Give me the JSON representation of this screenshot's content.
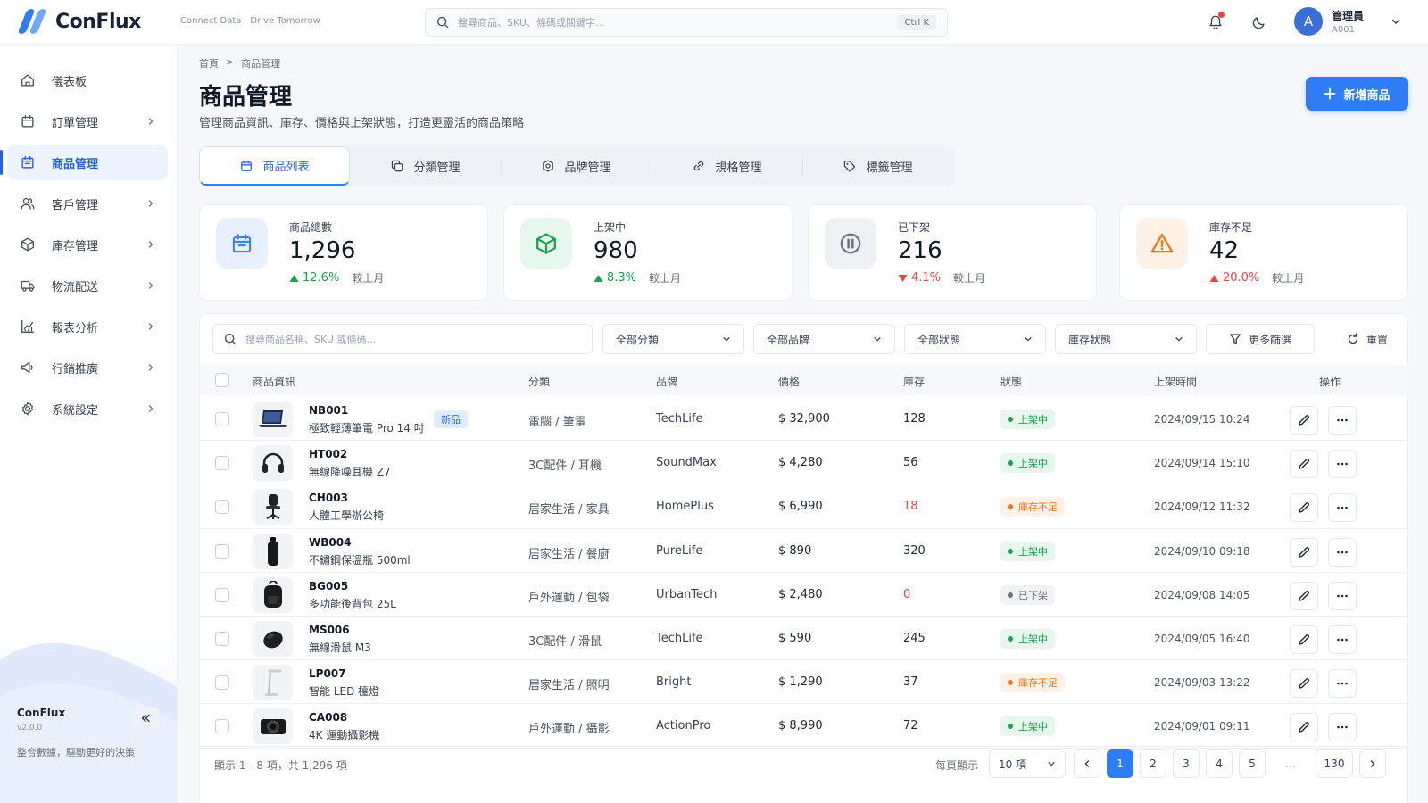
{
  "app": {
    "name": "ConFlux",
    "tagline": [
      "Connect Data",
      "Drive Tomorrow"
    ]
  },
  "topbar": {
    "search_placeholder": "搜尋商品、SKU、條碼或關鍵字...",
    "shortcut": "Ctrl K",
    "user": {
      "initial": "A",
      "name": "管理員",
      "id": "A001"
    },
    "icons": [
      "bell-icon",
      "moon-icon",
      "chevron-down-icon"
    ]
  },
  "sidebar": {
    "items": [
      {
        "label": "儀表板",
        "icon": "home-icon",
        "chevron": false,
        "active": false
      },
      {
        "label": "訂單管理",
        "icon": "order-icon",
        "chevron": true,
        "active": false
      },
      {
        "label": "商品管理",
        "icon": "product-icon",
        "chevron": false,
        "active": true
      },
      {
        "label": "客戶管理",
        "icon": "users-icon",
        "chevron": true,
        "active": false
      },
      {
        "label": "庫存管理",
        "icon": "box-icon",
        "chevron": true,
        "active": false
      },
      {
        "label": "物流配送",
        "icon": "truck-icon",
        "chevron": true,
        "active": false
      },
      {
        "label": "報表分析",
        "icon": "chart-icon",
        "chevron": true,
        "active": false
      },
      {
        "label": "行銷推廣",
        "icon": "megaphone-icon",
        "chevron": true,
        "active": false
      },
      {
        "label": "系統設定",
        "icon": "gear-icon",
        "chevron": true,
        "active": false
      }
    ],
    "footer": {
      "brand": "ConFlux",
      "version": "v2.0.0",
      "slogan": "整合數據，驅動更好的決策"
    }
  },
  "page": {
    "breadcrumb": [
      "首頁",
      "商品管理"
    ],
    "title": "商品管理",
    "subtitle": "管理商品資訊、庫存、價格與上架狀態，打造更靈活的商品策略",
    "add_button": "新增商品"
  },
  "tabs": [
    {
      "label": "商品列表",
      "icon": "calendar-bag-icon",
      "active": true
    },
    {
      "label": "分類管理",
      "icon": "layers-icon",
      "active": false
    },
    {
      "label": "品牌管理",
      "icon": "badge-icon",
      "active": false
    },
    {
      "label": "規格管理",
      "icon": "link-icon",
      "active": false
    },
    {
      "label": "標籤管理",
      "icon": "tag-icon",
      "active": false
    }
  ],
  "stats": [
    {
      "label": "商品總數",
      "value": "1,296",
      "change": "12.6%",
      "direction": "up",
      "compare": "較上月",
      "color": "#3b82f6",
      "bg": "#e8f0ff",
      "change_color": "#16a34a"
    },
    {
      "label": "上架中",
      "value": "980",
      "change": "8.3%",
      "direction": "up",
      "compare": "較上月",
      "color": "#16a34a",
      "bg": "#e6f7ee",
      "change_color": "#16a34a"
    },
    {
      "label": "已下架",
      "value": "216",
      "change": "4.1%",
      "direction": "down",
      "compare": "較上月",
      "color": "#6b7280",
      "bg": "#eef0f4",
      "change_color": "#ef4444"
    },
    {
      "label": "庫存不足",
      "value": "42",
      "change": "20.0%",
      "direction": "up",
      "compare": "較上月",
      "color": "#f97316",
      "bg": "#fff1e6",
      "change_color": "#ef4444"
    }
  ],
  "filters": {
    "search_placeholder": "搜尋商品名稱、SKU 或條碼...",
    "selects": [
      "全部分類",
      "全部品牌",
      "全部狀態",
      "庫存狀態"
    ],
    "more": "更多篩選",
    "reset": "重置"
  },
  "table": {
    "headers": [
      "商品資訊",
      "分類",
      "品牌",
      "價格",
      "庫存",
      "狀態",
      "上架時間",
      "操作"
    ],
    "rows": [
      {
        "sku": "NB001",
        "name": "極致輕薄筆電 Pro 14 吋",
        "tag": "新品",
        "thumb": "laptop",
        "category": "電腦 / 筆電",
        "brand": "TechLife",
        "price": "$ 32,900",
        "stock": "128",
        "low": false,
        "status": "上架中",
        "status_type": "on",
        "time": "2024/09/15 10:24"
      },
      {
        "sku": "HT002",
        "name": "無線降噪耳機 Z7",
        "tag": "",
        "thumb": "headphones",
        "category": "3C配件 / 耳機",
        "brand": "SoundMax",
        "price": "$ 4,280",
        "stock": "56",
        "low": false,
        "status": "上架中",
        "status_type": "on",
        "time": "2024/09/14 15:10"
      },
      {
        "sku": "CH003",
        "name": "人體工學辦公椅",
        "tag": "",
        "thumb": "chair",
        "category": "居家生活 / 家具",
        "brand": "HomePlus",
        "price": "$ 6,990",
        "stock": "18",
        "low": true,
        "status": "庫存不足",
        "status_type": "low",
        "time": "2024/09/12 11:32"
      },
      {
        "sku": "WB004",
        "name": "不鏽鋼保溫瓶 500ml",
        "tag": "",
        "thumb": "bottle",
        "category": "居家生活 / 餐廚",
        "brand": "PureLife",
        "price": "$ 890",
        "stock": "320",
        "low": false,
        "status": "上架中",
        "status_type": "on",
        "time": "2024/09/10 09:18"
      },
      {
        "sku": "BG005",
        "name": "多功能後背包 25L",
        "tag": "",
        "thumb": "backpack",
        "category": "戶外運動 / 包袋",
        "brand": "UrbanTech",
        "price": "$ 2,480",
        "stock": "0",
        "low": true,
        "status": "已下架",
        "status_type": "off",
        "time": "2024/09/08 14:05"
      },
      {
        "sku": "MS006",
        "name": "無線滑鼠 M3",
        "tag": "",
        "thumb": "mouse",
        "category": "3C配件 / 滑鼠",
        "brand": "TechLife",
        "price": "$ 590",
        "stock": "245",
        "low": false,
        "status": "上架中",
        "status_type": "on",
        "time": "2024/09/05 16:40"
      },
      {
        "sku": "LP007",
        "name": "智能 LED 檯燈",
        "tag": "",
        "thumb": "lamp",
        "category": "居家生活 / 照明",
        "brand": "Bright",
        "price": "$ 1,290",
        "stock": "37",
        "low": false,
        "status": "庫存不足",
        "status_type": "low",
        "time": "2024/09/03 13:22"
      },
      {
        "sku": "CA008",
        "name": "4K 運動攝影機",
        "tag": "",
        "thumb": "camera",
        "category": "戶外運動 / 攝影",
        "brand": "ActionPro",
        "price": "$ 8,990",
        "stock": "72",
        "low": false,
        "status": "上架中",
        "status_type": "on",
        "time": "2024/09/01 09:11"
      }
    ]
  },
  "pagination": {
    "info": "顯示 1 - 8 項，共 1,296 項",
    "per_page_label": "每頁顯示",
    "per_page": "10 項",
    "pages": [
      "1",
      "2",
      "3",
      "4",
      "5",
      "...",
      "130"
    ],
    "current": "1"
  }
}
